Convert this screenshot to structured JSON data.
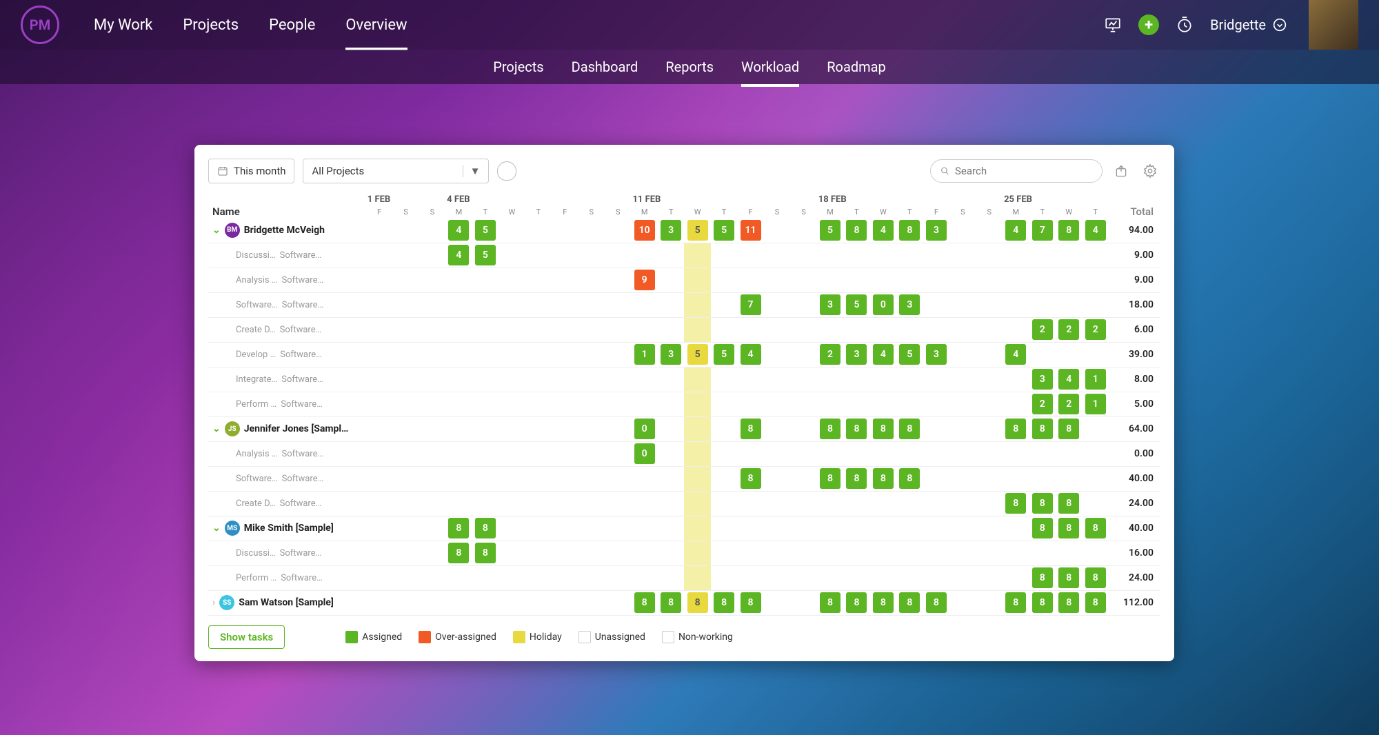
{
  "header": {
    "logo": "PM",
    "nav": [
      "My Work",
      "Projects",
      "People",
      "Overview"
    ],
    "nav_active": 3,
    "user": "Bridgette"
  },
  "subnav": {
    "items": [
      "Projects",
      "Dashboard",
      "Reports",
      "Workload",
      "Roadmap"
    ],
    "active": 3
  },
  "toolbar": {
    "range": "This month",
    "project_filter": "All Projects",
    "search_placeholder": "Search"
  },
  "columns": {
    "weeks": [
      {
        "label": "1 FEB",
        "days": [
          "F",
          "S",
          "S"
        ]
      },
      {
        "label": "4 FEB",
        "days": [
          "M",
          "T",
          "W",
          "T",
          "F",
          "S",
          "S"
        ]
      },
      {
        "label": "11 FEB",
        "days": [
          "M",
          "T",
          "W",
          "T",
          "F",
          "S",
          "S"
        ]
      },
      {
        "label": "18 FEB",
        "days": [
          "M",
          "T",
          "W",
          "T",
          "F",
          "S",
          "S"
        ]
      },
      {
        "label": "25 FEB",
        "days": [
          "M",
          "T",
          "W",
          "T"
        ]
      }
    ],
    "name_header": "Name",
    "total_header": "Total",
    "holiday_index": 12
  },
  "legend": {
    "assigned": "Assigned",
    "over": "Over-assigned",
    "holiday": "Holiday",
    "unassigned": "Unassigned",
    "nonworking": "Non-working",
    "show_tasks": "Show tasks"
  },
  "rows": [
    {
      "type": "person",
      "expanded": true,
      "badge": "BM",
      "badge_color": "#7b2a9e",
      "name": "Bridgette McVeigh",
      "total": "94.00",
      "cells": {
        "3": [
          "g",
          "4"
        ],
        "4": [
          "g",
          "5"
        ],
        "10": [
          "o",
          "10"
        ],
        "11": [
          "g",
          "3"
        ],
        "12": [
          "y",
          "5"
        ],
        "13": [
          "g",
          "5"
        ],
        "14": [
          "o",
          "11"
        ],
        "17": [
          "g",
          "5"
        ],
        "18": [
          "g",
          "8"
        ],
        "19": [
          "g",
          "4"
        ],
        "20": [
          "g",
          "8"
        ],
        "21": [
          "g",
          "3"
        ],
        "24": [
          "g",
          "4"
        ],
        "25": [
          "g",
          "7"
        ],
        "26": [
          "g",
          "8"
        ],
        "27": [
          "g",
          "4"
        ]
      }
    },
    {
      "type": "task",
      "task": "Discussi…",
      "project": "Software…",
      "total": "9.00",
      "cells": {
        "3": [
          "g",
          "4"
        ],
        "4": [
          "g",
          "5"
        ]
      }
    },
    {
      "type": "task",
      "task": "Analysis …",
      "project": "Software…",
      "total": "9.00",
      "cells": {
        "10": [
          "o",
          "9"
        ]
      }
    },
    {
      "type": "task",
      "task": "Software…",
      "project": "Software…",
      "total": "18.00",
      "cells": {
        "14": [
          "g",
          "7"
        ],
        "17": [
          "g",
          "3"
        ],
        "18": [
          "g",
          "5"
        ],
        "19": [
          "g",
          "0"
        ],
        "20": [
          "g",
          "3"
        ]
      }
    },
    {
      "type": "task",
      "task": "Create D…",
      "project": "Software…",
      "total": "6.00",
      "cells": {
        "25": [
          "g",
          "2"
        ],
        "26": [
          "g",
          "2"
        ],
        "27": [
          "g",
          "2"
        ]
      }
    },
    {
      "type": "task",
      "task": "Develop …",
      "project": "Software…",
      "total": "39.00",
      "cells": {
        "10": [
          "g",
          "1"
        ],
        "11": [
          "g",
          "3"
        ],
        "12": [
          "y",
          "5"
        ],
        "13": [
          "g",
          "5"
        ],
        "14": [
          "g",
          "4"
        ],
        "17": [
          "g",
          "2"
        ],
        "18": [
          "g",
          "3"
        ],
        "19": [
          "g",
          "4"
        ],
        "20": [
          "g",
          "5"
        ],
        "21": [
          "g",
          "3"
        ],
        "24": [
          "g",
          "4"
        ]
      }
    },
    {
      "type": "task",
      "task": "Integrate…",
      "project": "Software…",
      "total": "8.00",
      "cells": {
        "25": [
          "g",
          "3"
        ],
        "26": [
          "g",
          "4"
        ],
        "27": [
          "g",
          "1"
        ]
      }
    },
    {
      "type": "task",
      "task": "Perform …",
      "project": "Software…",
      "total": "5.00",
      "cells": {
        "25": [
          "g",
          "2"
        ],
        "26": [
          "g",
          "2"
        ],
        "27": [
          "g",
          "1"
        ]
      }
    },
    {
      "type": "person",
      "expanded": true,
      "badge": "JS",
      "badge_color": "#8fae2e",
      "name": "Jennifer Jones [Sampl…",
      "total": "64.00",
      "cells": {
        "10": [
          "g",
          "0"
        ],
        "14": [
          "g",
          "8"
        ],
        "17": [
          "g",
          "8"
        ],
        "18": [
          "g",
          "8"
        ],
        "19": [
          "g",
          "8"
        ],
        "20": [
          "g",
          "8"
        ],
        "24": [
          "g",
          "8"
        ],
        "25": [
          "g",
          "8"
        ],
        "26": [
          "g",
          "8"
        ]
      }
    },
    {
      "type": "task",
      "task": "Analysis …",
      "project": "Software…",
      "total": "0.00",
      "cells": {
        "10": [
          "g",
          "0"
        ]
      }
    },
    {
      "type": "task",
      "task": "Software…",
      "project": "Software…",
      "total": "40.00",
      "cells": {
        "14": [
          "g",
          "8"
        ],
        "17": [
          "g",
          "8"
        ],
        "18": [
          "g",
          "8"
        ],
        "19": [
          "g",
          "8"
        ],
        "20": [
          "g",
          "8"
        ]
      }
    },
    {
      "type": "task",
      "task": "Create D…",
      "project": "Software…",
      "total": "24.00",
      "cells": {
        "24": [
          "g",
          "8"
        ],
        "25": [
          "g",
          "8"
        ],
        "26": [
          "g",
          "8"
        ]
      }
    },
    {
      "type": "person",
      "expanded": true,
      "badge": "MS",
      "badge_color": "#2e8fc4",
      "name": "Mike Smith [Sample]",
      "total": "40.00",
      "cells": {
        "3": [
          "g",
          "8"
        ],
        "4": [
          "g",
          "8"
        ],
        "25": [
          "g",
          "8"
        ],
        "26": [
          "g",
          "8"
        ],
        "27": [
          "g",
          "8"
        ]
      }
    },
    {
      "type": "task",
      "task": "Discussi…",
      "project": "Software…",
      "total": "16.00",
      "cells": {
        "3": [
          "g",
          "8"
        ],
        "4": [
          "g",
          "8"
        ]
      }
    },
    {
      "type": "task",
      "task": "Perform …",
      "project": "Software…",
      "total": "24.00",
      "cells": {
        "25": [
          "g",
          "8"
        ],
        "26": [
          "g",
          "8"
        ],
        "27": [
          "g",
          "8"
        ]
      }
    },
    {
      "type": "person",
      "expanded": false,
      "badge": "SS",
      "badge_color": "#3dc4e0",
      "name": "Sam Watson [Sample]",
      "total": "112.00",
      "cells": {
        "10": [
          "g",
          "8"
        ],
        "11": [
          "g",
          "8"
        ],
        "12": [
          "y",
          "8"
        ],
        "13": [
          "g",
          "8"
        ],
        "14": [
          "g",
          "8"
        ],
        "17": [
          "g",
          "8"
        ],
        "18": [
          "g",
          "8"
        ],
        "19": [
          "g",
          "8"
        ],
        "20": [
          "g",
          "8"
        ],
        "21": [
          "g",
          "8"
        ],
        "24": [
          "g",
          "8"
        ],
        "25": [
          "g",
          "8"
        ],
        "26": [
          "g",
          "8"
        ],
        "27": [
          "g",
          "8"
        ]
      }
    }
  ]
}
